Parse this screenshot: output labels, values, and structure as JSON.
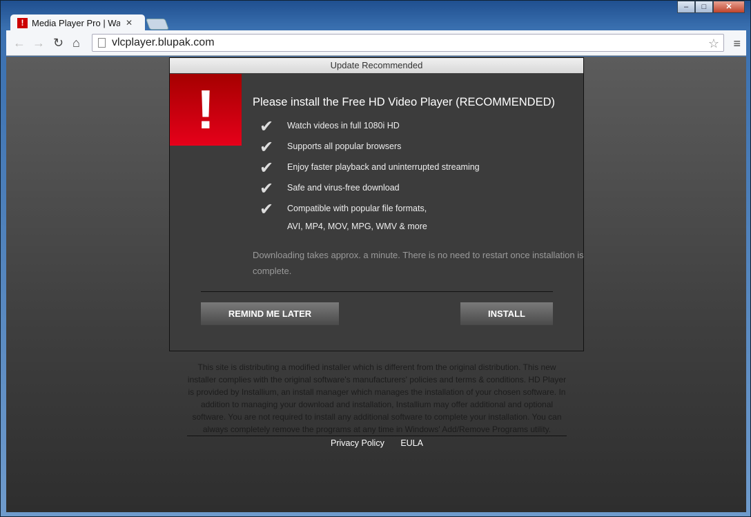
{
  "browser": {
    "tab_title": "Media Player Pro | Watch Movies",
    "url": "vlcplayer.blupak.com"
  },
  "dialog": {
    "header": "Update Recommended",
    "title": "Please install the Free HD Video Player (RECOMMENDED)",
    "features": [
      "Watch videos in full 1080i HD",
      "Supports all popular browsers",
      "Enjoy faster playback and uninterrupted streaming",
      "Safe and virus-free download",
      "Compatible with popular file formats,"
    ],
    "features_sub": "AVI, MP4, MOV, MPG, WMV & more",
    "note": "Downloading takes approx. a minute. There is no need to restart once installation is complete.",
    "remind_label": "REMIND ME LATER",
    "install_label": "INSTALL"
  },
  "disclaimer": "This site is distributing a modified installer which is different from the original distribution. This new installer complies with the original software's manufacturers' policies and terms & conditions. HD Player is provided by Installium, an install manager which manages the installation of your chosen software. In addition to managing your download and installation, Installium may offer additional and optional software. You are not required to install any additional software to complete your installation. You can always completely remove the programs at any time in Windows' Add/Remove Programs utility.",
  "footer": {
    "privacy": "Privacy Policy",
    "eula": "EULA"
  }
}
